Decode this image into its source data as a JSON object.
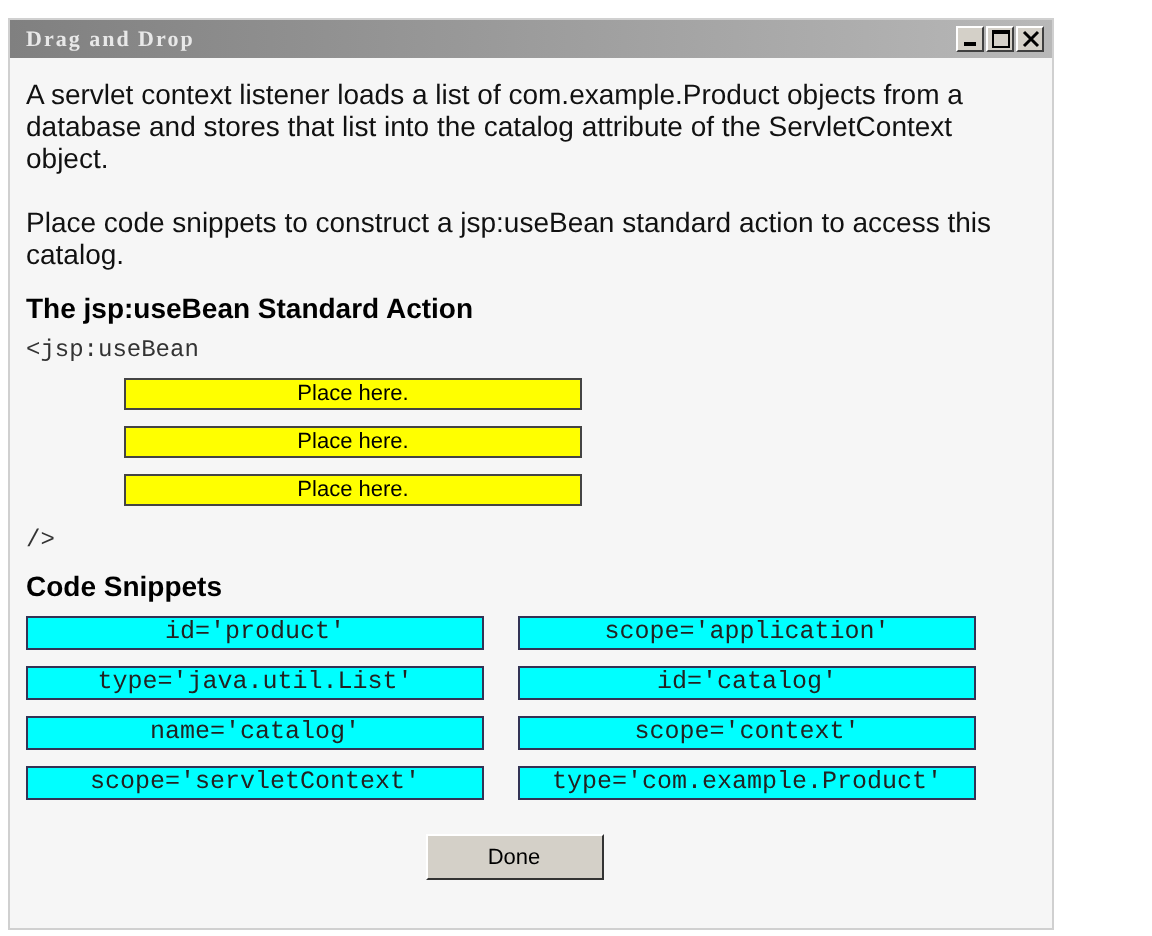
{
  "window": {
    "title": "Drag and Drop"
  },
  "intro": [
    "A servlet context listener loads a list of com.example.Product objects from a database and stores that list into the catalog attribute of the ServletContext object.",
    "Place code snippets to construct a jsp:useBean standard action to access this catalog."
  ],
  "action": {
    "heading": "The jsp:useBean Standard Action",
    "open_tag": "<jsp:useBean",
    "targets": [
      "Place here.",
      "Place here.",
      "Place here."
    ],
    "close_tag": "/>"
  },
  "snippets": {
    "heading": "Code Snippets",
    "items": [
      "id='product'",
      "scope='application'",
      "type='java.util.List'",
      "id='catalog'",
      "name='catalog'",
      "scope='context'",
      "scope='servletContext'",
      "type='com.example.Product'"
    ]
  },
  "buttons": [
    "Done"
  ]
}
